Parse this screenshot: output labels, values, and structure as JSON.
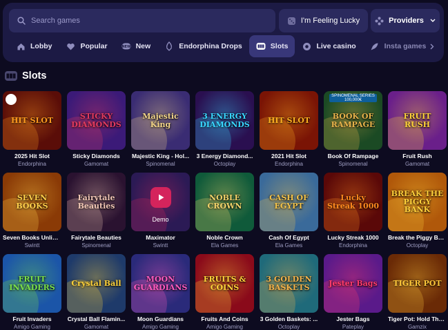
{
  "search": {
    "placeholder": "Search games"
  },
  "lucky_label": "I'm Feeling Lucky",
  "providers_label": "Providers",
  "nav": {
    "items": [
      {
        "label": "Lobby",
        "icon": "home-icon"
      },
      {
        "label": "Popular",
        "icon": "heart-icon"
      },
      {
        "label": "New",
        "icon": "new-icon"
      },
      {
        "label": "Endorphina Drops",
        "icon": "drops-icon"
      },
      {
        "label": "Slots",
        "icon": "slots-icon",
        "active": true
      },
      {
        "label": "Live casino",
        "icon": "live-icon"
      },
      {
        "label": "Insta games",
        "icon": "rocket-icon"
      }
    ]
  },
  "section": {
    "title": "Slots"
  },
  "demo_label": "Demo",
  "games": [
    {
      "title": "2025 Hit Slot",
      "provider": "Endorphina",
      "art": "HIT SLOT",
      "bg": "#5a0d08",
      "accent": "#ff9a1f"
    },
    {
      "title": "Sticky Diamonds",
      "provider": "Gamomat",
      "art": "STICKY DIAMONDS",
      "bg": "#3b1a78",
      "accent": "#e23a5e"
    },
    {
      "title": "Majestic King - Hol...",
      "provider": "Spinomenal",
      "art": "Majestic King",
      "bg": "#3a2c73",
      "accent": "#f2d589"
    },
    {
      "title": "3 Energy Diamond...",
      "provider": "Octoplay",
      "art": "3 ENERGY DIAMONDS",
      "bg": "#2a0f50",
      "accent": "#39d6ff"
    },
    {
      "title": "2021 Hit Slot",
      "provider": "Endorphina",
      "art": "HIT SLOT",
      "bg": "#7a1405",
      "accent": "#ffb020"
    },
    {
      "title": "Book Of Rampage",
      "provider": "Spinomenal",
      "art": "BOOK OF RAMPAGE",
      "bg": "#1b4a24",
      "accent": "#e6b24a",
      "ribbon": "SPINOMENAL SERIES 100,000€"
    },
    {
      "title": "Fruit Rush",
      "provider": "Gamomat",
      "art": "FRUIT RUSH",
      "bg": "#6a1f8a",
      "accent": "#ffd23a"
    },
    {
      "title": "Seven Books Unlim...",
      "provider": "Swintt",
      "art": "SEVEN BOOKS",
      "bg": "#8a3a06",
      "accent": "#ffcf4a"
    },
    {
      "title": "Fairytale Beauties",
      "provider": "Spinomenal",
      "art": "Fairytale Beauties",
      "bg": "#2a1230",
      "accent": "#f1c6b5"
    },
    {
      "title": "Maximator",
      "provider": "Swintt",
      "art": "",
      "bg": "#2b1a55",
      "accent": "#d4245c",
      "demo": true
    },
    {
      "title": "Noble Crown",
      "provider": "Ela Games",
      "art": "NOBLE CROWN",
      "bg": "#0f5a3a",
      "accent": "#f2d36a"
    },
    {
      "title": "Cash Of Egypt",
      "provider": "Ela Games",
      "art": "CASH OF EGYPT",
      "bg": "#3a6a9a",
      "accent": "#f2c24a"
    },
    {
      "title": "Lucky Streak 1000",
      "provider": "Endorphina",
      "art": "Lucky Streak 1000",
      "bg": "#5a0808",
      "accent": "#ff8a1f"
    },
    {
      "title": "Break the Piggy Bank",
      "provider": "Octoplay",
      "art": "BREAK THE PIGGY BANK",
      "bg": "#b0580a",
      "accent": "#ffcf3a"
    },
    {
      "title": "Fruit Invaders",
      "provider": "Amigo Gaming",
      "art": "FRUIT INVADERS",
      "bg": "#1b55a8",
      "accent": "#7be04a"
    },
    {
      "title": "Crystal Ball Flamin...",
      "provider": "Gamomat",
      "art": "Crystal Ball",
      "bg": "#1e3a6a",
      "accent": "#ffd23a"
    },
    {
      "title": "Moon Guardians",
      "provider": "Amigo Gaming",
      "art": "MOON GUARDIANS",
      "bg": "#2a2a7a",
      "accent": "#ff5ac0"
    },
    {
      "title": "Fruits And Coins",
      "provider": "Amigo Gaming",
      "art": "FRUITS & COINS",
      "bg": "#8a0a1a",
      "accent": "#ffd23a"
    },
    {
      "title": "3 Golden Baskets: ...",
      "provider": "Octoplay",
      "art": "3 GOLDEN BASKETS",
      "bg": "#1f6a7a",
      "accent": "#f2b24a"
    },
    {
      "title": "Jester Bags",
      "provider": "Pateplay",
      "art": "Jester Bags",
      "bg": "#5a1a8a",
      "accent": "#ff3a6a"
    },
    {
      "title": "Tiger Pot: Hold The...",
      "provider": "Gamzix",
      "art": "TIGER POT",
      "bg": "#6a2a06",
      "accent": "#ffc83a"
    }
  ],
  "colors": {
    "panel": "#1c1a44",
    "field": "#2b2a5e",
    "active_tab": "#383779",
    "page_bg": "#0d0b20",
    "demo_accent": "#d4245c"
  }
}
